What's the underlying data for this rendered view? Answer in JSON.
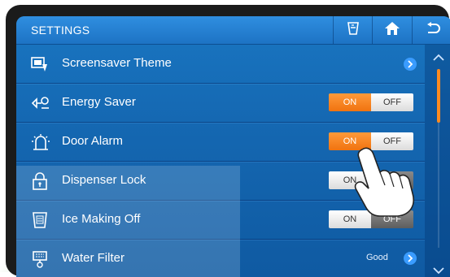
{
  "header": {
    "title": "SETTINGS",
    "buttons": [
      {
        "icon": "water-glass-icon"
      },
      {
        "icon": "home-icon"
      },
      {
        "icon": "back-arrow-icon"
      }
    ]
  },
  "rows": [
    {
      "label": "Screensaver Theme",
      "icon": "screensaver-icon",
      "control": "chevron"
    },
    {
      "label": "Energy Saver",
      "icon": "energy-saver-icon",
      "control": "toggle",
      "on_label": "ON",
      "off_label": "OFF",
      "value": "ON"
    },
    {
      "label": "Door Alarm",
      "icon": "door-alarm-icon",
      "control": "toggle",
      "on_label": "ON",
      "off_label": "OFF",
      "value": "ON"
    },
    {
      "label": "Dispenser Lock",
      "icon": "lock-icon",
      "control": "toggle",
      "on_label": "ON",
      "off_label": "OFF",
      "value": "OFF"
    },
    {
      "label": "Ice Making Off",
      "icon": "ice-off-icon",
      "control": "toggle",
      "on_label": "ON",
      "off_label": "OFF",
      "value": "OFF"
    },
    {
      "label": "Water Filter",
      "icon": "water-filter-icon",
      "control": "status",
      "status": "Good"
    }
  ],
  "colors": {
    "accent": "#F07310",
    "screen": "#1568B2",
    "scroll_thumb": "#FF8A1F"
  }
}
